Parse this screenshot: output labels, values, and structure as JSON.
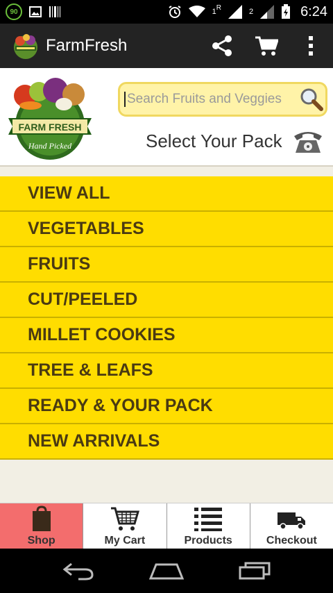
{
  "status_bar": {
    "badge": "90",
    "time": "6:24",
    "signal_1": "1",
    "signal_r": "R",
    "signal_2": "2"
  },
  "action_bar": {
    "title": "FarmFresh",
    "icons": [
      "share-icon",
      "cart-icon",
      "overflow-menu-icon"
    ]
  },
  "header": {
    "logo_text": "FARM FRESH",
    "logo_tagline": "Hand Picked",
    "search": {
      "placeholder": "Search Fruits and Veggies",
      "value": ""
    },
    "pack_label": "Select Your Pack"
  },
  "menu": {
    "items": [
      {
        "label": "VIEW ALL"
      },
      {
        "label": "VEGETABLES"
      },
      {
        "label": "FRUITS"
      },
      {
        "label": "CUT/PEELED"
      },
      {
        "label": "MILLET COOKIES"
      },
      {
        "label": "TREE & LEAFS"
      },
      {
        "label": "READY & YOUR PACK"
      },
      {
        "label": "NEW ARRIVALS"
      }
    ]
  },
  "tabs": [
    {
      "label": "Shop",
      "icon": "shopping-bag-icon",
      "active": true
    },
    {
      "label": "My Cart",
      "icon": "cart-icon",
      "active": false
    },
    {
      "label": "Products",
      "icon": "list-icon",
      "active": false
    },
    {
      "label": "Checkout",
      "icon": "truck-icon",
      "active": false
    }
  ],
  "colors": {
    "menu_bg": "#ffdd00",
    "menu_text": "#4a3a12",
    "active_tab": "#f36d6d",
    "action_bar": "#232323",
    "search_bg": "#fff3a8"
  }
}
